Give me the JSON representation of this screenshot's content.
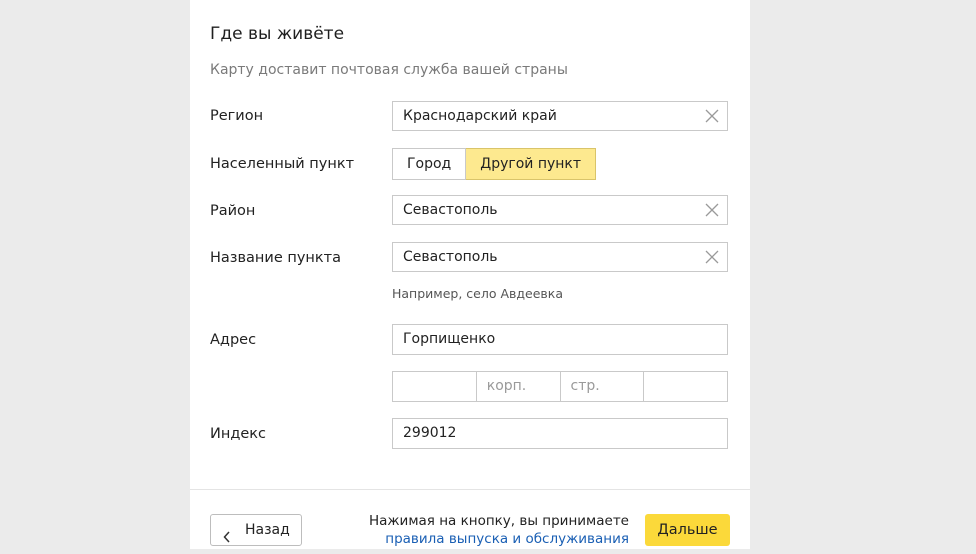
{
  "section": {
    "title": "Где вы живёте",
    "subtitle": "Карту доставит почтовая служба вашей страны"
  },
  "form": {
    "region": {
      "label": "Регион",
      "value": "Краснодарский край"
    },
    "settlement_type": {
      "label": "Населенный пункт",
      "options": [
        "Город",
        "Другой пункт"
      ],
      "selected": "Другой пункт"
    },
    "district": {
      "label": "Район",
      "value": "Севастополь"
    },
    "place_name": {
      "label": "Название пункта",
      "value": "Севастополь",
      "hint": "Например, село Авдеевка"
    },
    "address": {
      "label": "Адрес",
      "street": "Горпищенко",
      "house": "",
      "building_placeholder": "корп.",
      "structure_placeholder": "стр.",
      "apartment": ""
    },
    "postal_index": {
      "label": "Индекс",
      "value": "299012"
    }
  },
  "footer": {
    "back_label": "Назад",
    "terms_text": "Нажимая на кнопку, вы принимаете",
    "terms_link": "правила выпуска и обслуживания",
    "next_label": "Дальше"
  },
  "colors": {
    "primary_button": "#fbd93a",
    "active_toggle": "#fde98f",
    "link": "#1a5fb4"
  },
  "icons": {
    "clear": "close-icon",
    "back": "chevron-left-icon"
  }
}
